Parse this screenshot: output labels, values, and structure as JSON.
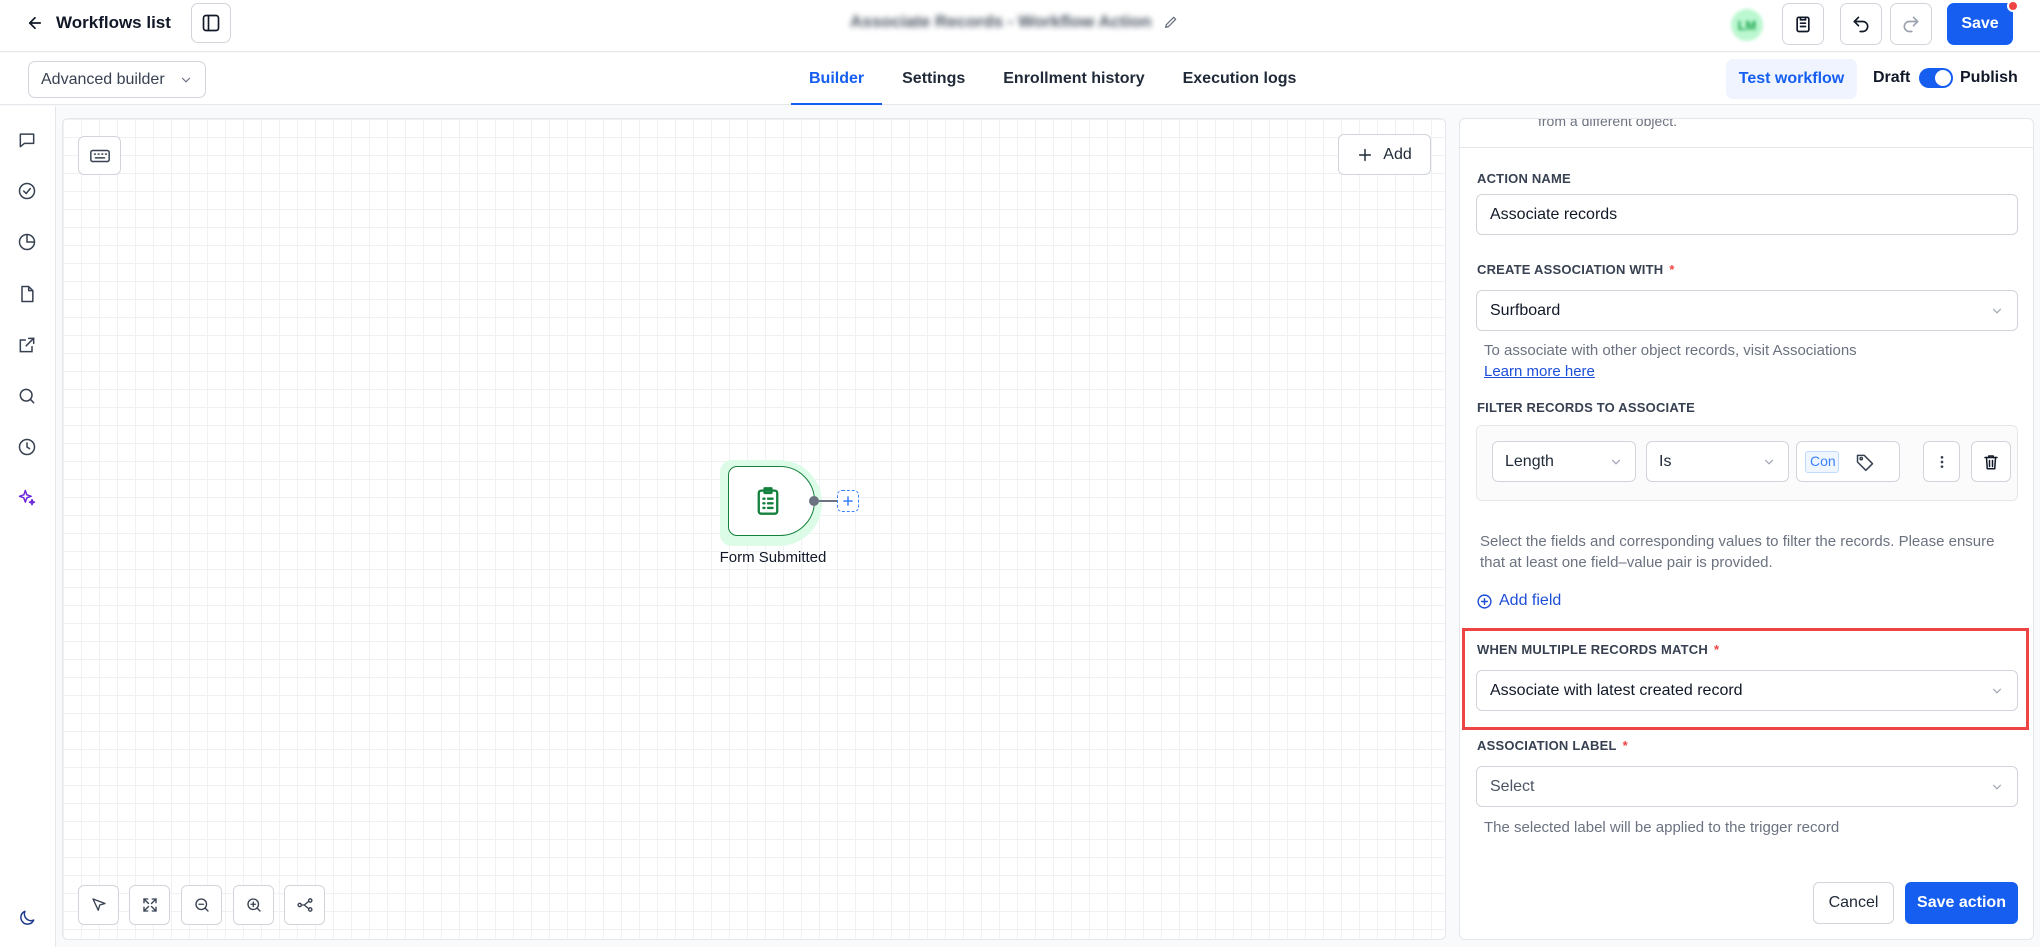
{
  "header": {
    "back_label": "Workflows list",
    "workflow_title": "Associate Records - Workflow Action",
    "avatar_initials": "LM",
    "save_label": "Save"
  },
  "subbar": {
    "mode_value": "Advanced builder",
    "tabs": [
      {
        "label": "Builder",
        "active": true
      },
      {
        "label": "Settings",
        "active": false
      },
      {
        "label": "Enrollment history",
        "active": false
      },
      {
        "label": "Execution logs",
        "active": false
      }
    ],
    "test_label": "Test workflow",
    "draft_label": "Draft",
    "publish_label": "Publish",
    "publish_toggle_on": true
  },
  "rail": {
    "icons": [
      "chat-icon",
      "check-circle-icon",
      "pie-chart-icon",
      "file-icon",
      "external-link-icon",
      "search-icon",
      "history-icon",
      "sparkles-icon",
      "moon-icon"
    ]
  },
  "canvas": {
    "add_label": "Add",
    "node_label": "Form Submitted",
    "controls": [
      "pointer-icon",
      "fit-view-icon",
      "zoom-out-icon",
      "zoom-in-icon",
      "auto-layout-icon"
    ]
  },
  "panel": {
    "cut_text": "from a different object.",
    "action_name_label": "ACTION NAME",
    "action_name_value": "Associate records",
    "create_assoc_label": "CREATE ASSOCIATION WITH",
    "create_assoc_value": "Surfboard",
    "assoc_help": "To associate with other object records, visit Associations",
    "learn_more": "Learn more here",
    "filter_label": "FILTER RECORDS TO ASSOCIATE",
    "filter_field": "Length",
    "filter_operator": "Is",
    "filter_value_chip": "Con",
    "filter_help": "Select the fields and corresponding values to filter the records. Please ensure that at least one field–value pair is provided.",
    "add_field": "Add field",
    "multiple_label": "WHEN MULTIPLE RECORDS MATCH",
    "multiple_value": "Associate with latest created record",
    "assoc_label_label": "ASSOCIATION LABEL",
    "assoc_label_value": "Select",
    "assoc_label_help": "The selected label will be applied to the trigger record",
    "required_mark": "*",
    "cancel_label": "Cancel",
    "save_action_label": "Save action"
  },
  "colors": {
    "accent": "#155eef",
    "highlight": "#ef4444",
    "node_green": "#15803d"
  }
}
